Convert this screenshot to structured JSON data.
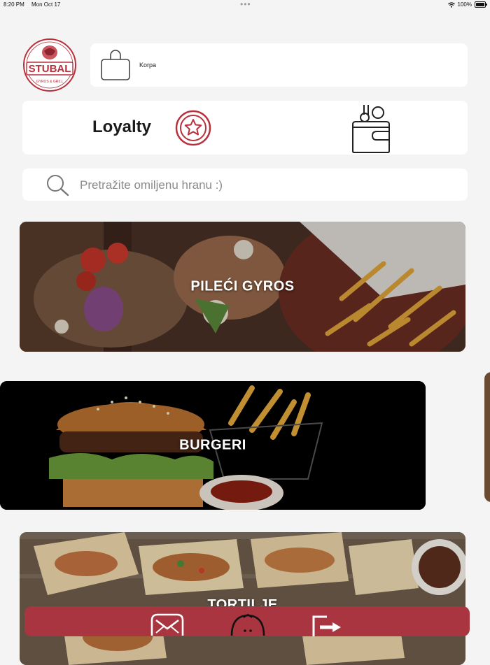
{
  "status_bar": {
    "time": "8:20 PM",
    "date": "Mon Oct 17",
    "battery": "100%"
  },
  "brand": {
    "name": "STUBAL",
    "tagline": "GYROS & GRILL",
    "color": "#b8303c"
  },
  "cart": {
    "label": "Korpa",
    "icon": "shopping-bag-icon"
  },
  "loyalty": {
    "label": "Loyalty",
    "star_icon": "star-circle-icon",
    "wallet_icon": "wallet-coins-icon"
  },
  "search": {
    "placeholder": "Pretražite omiljenu hranu :)",
    "value": ""
  },
  "categories": [
    {
      "label": "PILEĆI GYROS"
    },
    {
      "label": "BURGERI"
    },
    {
      "label": "TORTILJE"
    }
  ],
  "bottom_nav": {
    "color": "#a93540",
    "items": [
      {
        "icon": "envelope-icon"
      },
      {
        "icon": "home-icon"
      },
      {
        "icon": "logout-icon"
      }
    ]
  }
}
